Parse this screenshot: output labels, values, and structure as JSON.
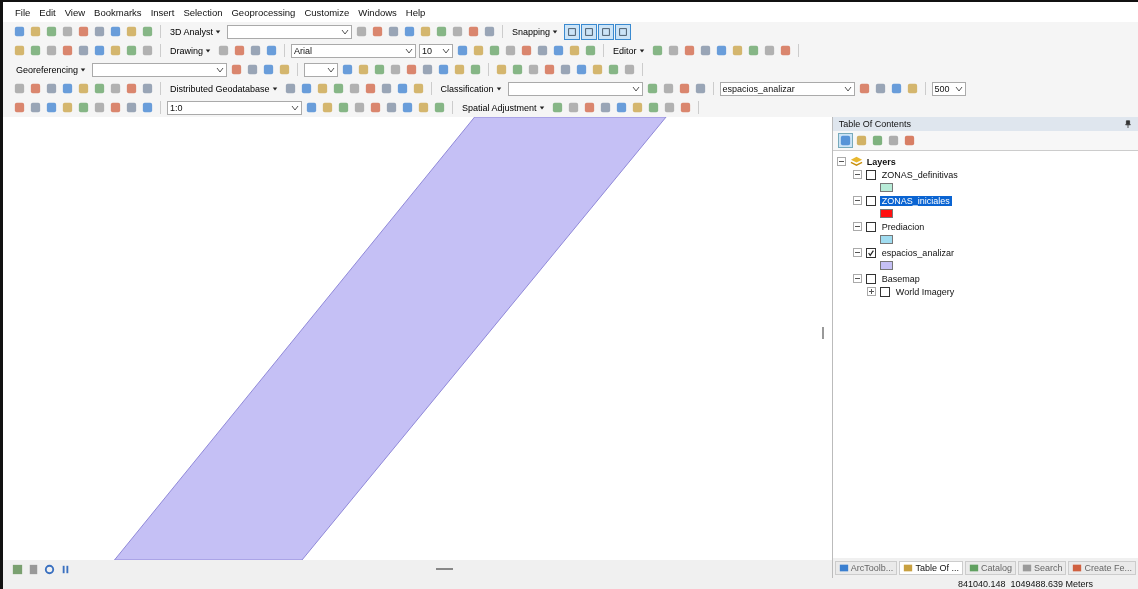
{
  "menu": [
    "File",
    "Edit",
    "View",
    "Bookmarks",
    "Insert",
    "Selection",
    "Geoprocessing",
    "Customize",
    "Windows",
    "Help"
  ],
  "toolbars": [
    [
      {
        "kind": "tools"
      },
      {
        "kind": "menu",
        "label": "3D Analyst"
      },
      {
        "kind": "combo"
      },
      {
        "kind": "tools"
      },
      {
        "kind": "menu",
        "label": "Snapping"
      },
      {
        "kind": "toggles",
        "items": [
          {
            "selected": true
          },
          {
            "selected": true
          },
          {
            "selected": true
          },
          {
            "selected": true
          }
        ]
      }
    ],
    [
      {
        "kind": "tools"
      },
      {
        "kind": "menu",
        "label": "Drawing"
      },
      {
        "kind": "few"
      },
      {
        "kind": "combo",
        "value": "Arial"
      },
      {
        "kind": "spin",
        "value": "10"
      },
      {
        "kind": "tools"
      },
      {
        "kind": "menu",
        "label": "Editor"
      },
      {
        "kind": "tools"
      }
    ],
    [
      {
        "kind": "menu",
        "label": "Georeferencing"
      },
      {
        "kind": "wide"
      },
      {
        "kind": "few"
      },
      {
        "kind": "spin"
      },
      {
        "kind": "tools"
      },
      {
        "kind": "tools"
      }
    ],
    [
      {
        "kind": "tools"
      },
      {
        "kind": "menu",
        "label": "Distributed Geodatabase"
      },
      {
        "kind": "tools"
      },
      {
        "kind": "menu",
        "label": "Classification"
      },
      {
        "kind": "wide"
      },
      {
        "kind": "few"
      },
      {
        "kind": "wide",
        "value": "espacios_analizar"
      },
      {
        "kind": "few"
      },
      {
        "kind": "spin",
        "value": "500"
      }
    ],
    [
      {
        "kind": "tools"
      },
      {
        "kind": "wide",
        "value": "1:0"
      },
      {
        "kind": "tools"
      },
      {
        "kind": "menu",
        "label": "Spatial Adjustment"
      },
      {
        "kind": "tools"
      }
    ]
  ],
  "toc": {
    "title": "Table Of Contents",
    "root": {
      "label": "Layers",
      "expanded": true,
      "children": [
        {
          "label": "ZONAS_definitivas",
          "checked": false,
          "expanded": true,
          "selected": false,
          "color": "#b8ecd8"
        },
        {
          "label": "ZONAS_iniciales",
          "checked": false,
          "expanded": true,
          "selected": true,
          "color": "#ff1010"
        },
        {
          "label": "Prediacion",
          "checked": false,
          "expanded": true,
          "selected": false,
          "color": "#a0dcf0"
        },
        {
          "label": "espacios_analizar",
          "checked": true,
          "expanded": true,
          "selected": false,
          "color": "#c5c0f5"
        },
        {
          "label": "Basemap",
          "checked": false,
          "expanded": true,
          "selected": false,
          "children": [
            {
              "label": "World Imagery",
              "checked": false,
              "expanded": false,
              "selected": false
            }
          ]
        }
      ]
    }
  },
  "tabs": [
    {
      "label": "ArcToolb...",
      "selected": false
    },
    {
      "label": "Table Of ...",
      "selected": true
    },
    {
      "label": "Catalog",
      "selected": false
    },
    {
      "label": "Search",
      "selected": false
    },
    {
      "label": "Create Fe...",
      "selected": false
    }
  ],
  "status": "841040.148  1049488.639 Meters"
}
